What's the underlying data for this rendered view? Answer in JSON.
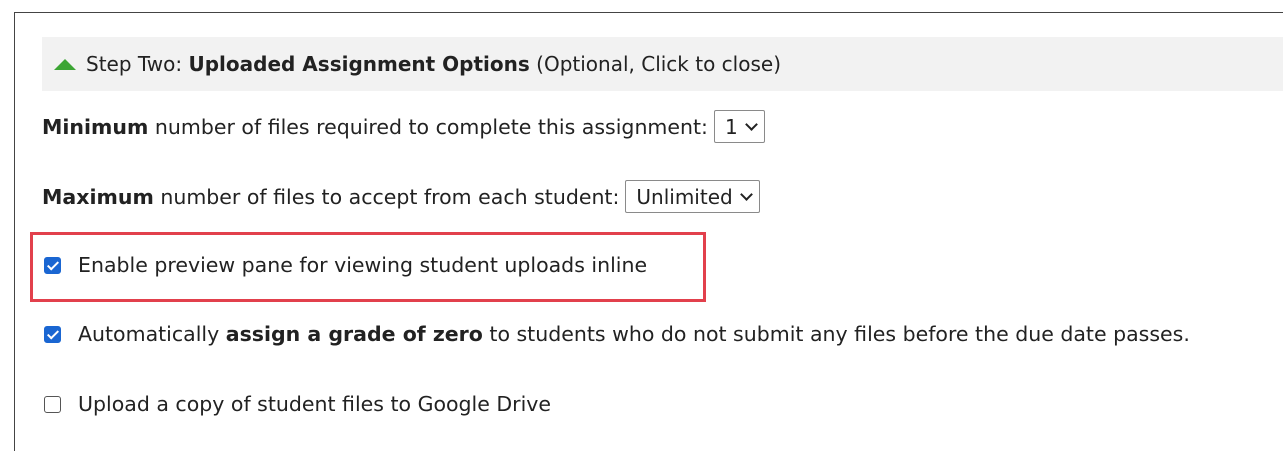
{
  "header": {
    "prefix": "Step Two: ",
    "title": "Uploaded Assignment Options",
    "suffix": " (Optional, Click to close)"
  },
  "min_files": {
    "label_bold": "Minimum",
    "label_rest": " number of files required to complete this assignment:",
    "value": "1"
  },
  "max_files": {
    "label_bold": "Maximum",
    "label_rest": " number of files to accept from each student:",
    "value": "Unlimited"
  },
  "preview_pane": {
    "label": "Enable preview pane for viewing student uploads inline",
    "checked": true
  },
  "auto_zero": {
    "label_pre": "Automatically ",
    "label_bold": "assign a grade of zero",
    "label_post": " to students who do not submit any files before the due date passes.",
    "checked": true
  },
  "google_drive": {
    "label": "Upload a copy of student files to Google Drive",
    "checked": false
  },
  "colors": {
    "header_bg": "#f2f2f2",
    "toggle_icon": "#3ca534",
    "checkbox_checked": "#1a66d2",
    "highlight": "#e2404c"
  }
}
